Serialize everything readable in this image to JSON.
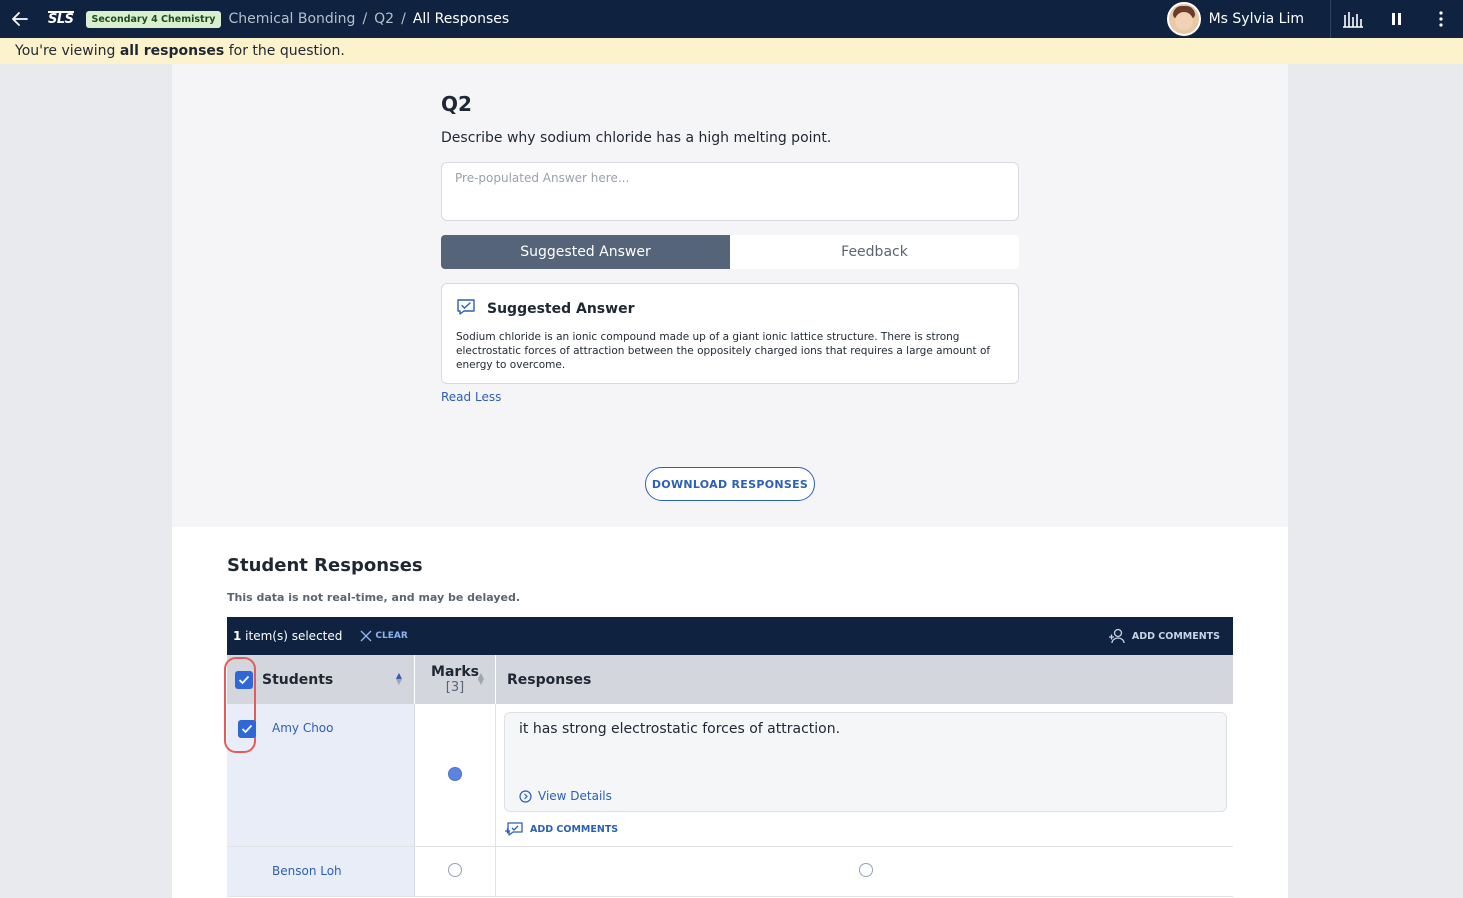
{
  "topbar": {
    "logo": "SLS",
    "course_badge": "Secondary 4 Chemistry",
    "breadcrumb": [
      "Chemical Bonding",
      "Q2",
      "All Responses"
    ],
    "user_name": "Ms Sylvia Lim"
  },
  "notice": {
    "prefix": "You're viewing ",
    "bold": "all responses",
    "suffix": " for the question."
  },
  "question": {
    "title": "Q2",
    "text": "Describe why sodium chloride has a high melting point.",
    "answer_placeholder": "Pre-populated Answer here...",
    "tabs": [
      "Suggested Answer",
      "Feedback"
    ],
    "active_tab": "Suggested Answer",
    "suggested_title": "Suggested Answer",
    "suggested_body": "Sodium chloride is an ionic compound made up of a giant ionic lattice structure. There is strong electrostatic forces of attraction between the oppositely charged ions that requires a large amount of energy to overcome.",
    "read_less": "Read Less",
    "download_label": "DOWNLOAD RESPONSES"
  },
  "responses": {
    "title": "Student Responses",
    "note": "This data is not real-time, and may be delayed.",
    "selection": {
      "count": "1",
      "count_suffix": " item(s) selected",
      "clear_label": "CLEAR",
      "add_comments_label": "ADD COMMENTS"
    },
    "columns": {
      "students": "Students",
      "marks": "Marks",
      "marks_total": "[3]",
      "responses": "Responses"
    },
    "rows": [
      {
        "student": "Amy Choo",
        "selected": true,
        "response": "it has strong electrostatic forces of attraction.",
        "view_details": "View Details",
        "add_comments": "ADD COMMENTS"
      },
      {
        "student": "Benson Loh",
        "selected": false,
        "response": ""
      }
    ]
  },
  "colors": {
    "navy": "#0f2341",
    "accent_blue": "#2b5fb8",
    "highlight_red": "#e35c5c",
    "notice_yellow": "#fcf2cc"
  }
}
